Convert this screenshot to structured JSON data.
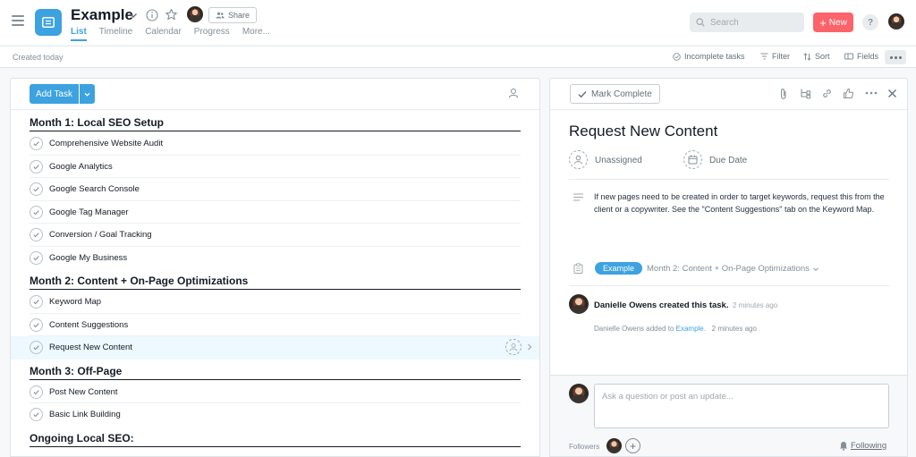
{
  "header": {
    "project_title": "Example",
    "share_label": "Share",
    "tabs": [
      {
        "label": "List",
        "active": true
      },
      {
        "label": "Timeline",
        "active": false
      },
      {
        "label": "Calendar",
        "active": false
      },
      {
        "label": "Progress",
        "active": false
      },
      {
        "label": "More..."
      }
    ],
    "search_placeholder": "Search",
    "new_label": "New",
    "help_label": "?"
  },
  "subbar": {
    "created": "Created today",
    "incomplete": "Incomplete tasks",
    "filter": "Filter",
    "sort": "Sort",
    "fields": "Fields"
  },
  "list": {
    "add_task_label": "Add Task",
    "sections": [
      {
        "title": "Month 1: Local SEO Setup",
        "tasks": [
          "Comprehensive Website Audit",
          "Google Analytics",
          "Google Search Console",
          "Google Tag Manager",
          "Conversion / Goal Tracking",
          "Google My Business"
        ]
      },
      {
        "title": "Month 2: Content + On-Page Optimizations",
        "tasks": [
          "Keyword Map",
          "Content Suggestions",
          "Request New Content"
        ]
      },
      {
        "title": "Month 3: Off-Page",
        "tasks": [
          "Post New Content",
          "Basic Link Building"
        ]
      },
      {
        "title": "Ongoing Local SEO:",
        "tasks": []
      }
    ],
    "selected_task": "Request New Content"
  },
  "detail": {
    "mark_complete_label": "Mark Complete",
    "title": "Request New Content",
    "assignee_label": "Unassigned",
    "due_date_label": "Due Date",
    "description": "If new pages need to be created in order to target keywords, request this from the client or a copywriter. See the \"Content Suggestions\" tab on the Keyword Map.",
    "project_pill": "Example",
    "section_label": "Month 2: Content + On-Page Optimizations",
    "story_main": "Danielle Owens created this task.",
    "story_time": "2 minutes ago",
    "story_sub_prefix": "Danielle Owens added to ",
    "story_sub_link": "Example.",
    "story_sub_time": "2 minutes ago",
    "comment_placeholder": "Ask a question or post an update...",
    "followers_label": "Followers",
    "add_follower": "+",
    "following_label": "Following"
  },
  "colors": {
    "accent": "#3da2e0",
    "new_button": "#fc636b",
    "selected_row": "#edf8ff"
  }
}
